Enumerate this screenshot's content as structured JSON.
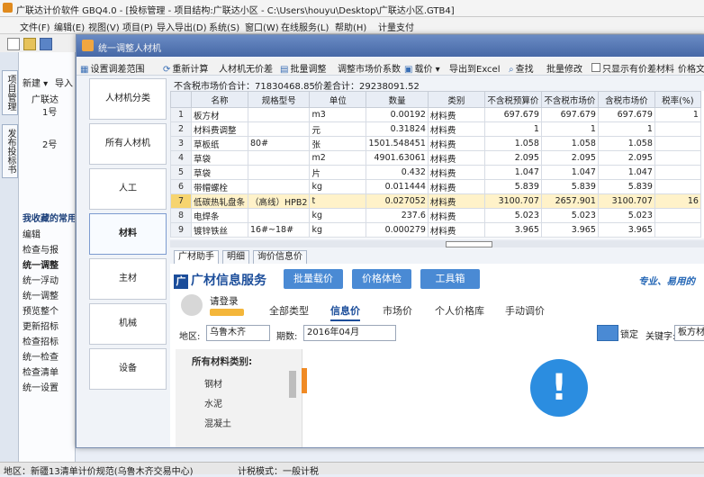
{
  "app": {
    "title": "广联达计价软件 GBQ4.0 - [投标管理 - 项目结构:广联达小区 - C:\\Users\\houyu\\Desktop\\广联达小区.GTB4]",
    "menu": [
      "文件(F)",
      "编辑(E)",
      "视图(V)",
      "项目(P)",
      "导入导出(D)",
      "系统(S)",
      "窗口(W)",
      "在线服务(L)",
      "帮助(H)",
      "计量支付"
    ],
    "vtabs": [
      "项目管理",
      "发布投标书"
    ],
    "left_toolbar": [
      "新建 ▾",
      "导入"
    ],
    "tree": [
      "广联达",
      "1号",
      "2号"
    ],
    "favorites_title": "我收藏的常用",
    "left_items": [
      "编辑",
      "检查与报",
      "统一调整",
      "统一浮动",
      "统一调整",
      "预览整个",
      "更新招标",
      "检查招标",
      "统一检查",
      "检查清单",
      "统一设置"
    ]
  },
  "dialog": {
    "title": "统一调整人材机",
    "toolbar": [
      "设置调差范围",
      "重新计算",
      "人材机无价差",
      "批量调整",
      "调整市场价系数",
      "载价 ▾",
      "导出到Excel",
      "查找",
      "批量修改",
      "只显示有价差材料",
      "价格文件"
    ],
    "sidebar": [
      "人材机分类",
      "所有人材机",
      "人工",
      "材料",
      "主材",
      "机械",
      "设备"
    ],
    "sidebar_active": 3,
    "summary": {
      "market_total": "不含税市场价合计：71830468.85",
      "diff_total": "价差合计：29238091.52"
    },
    "table": {
      "columns": [
        "",
        "名称",
        "规格型号",
        "单位",
        "数量",
        "类别",
        "不含税预算价",
        "不含税市场价",
        "含税市场价",
        "税率(%)"
      ],
      "selected_row": 6,
      "rows": [
        [
          "1",
          "板方材",
          "",
          "m3",
          "0.00192",
          "材料费",
          "697.679",
          "697.679",
          "697.679",
          "1"
        ],
        [
          "2",
          "材料费调整",
          "",
          "元",
          "0.31824",
          "材料费",
          "1",
          "1",
          "1",
          ""
        ],
        [
          "3",
          "草板纸",
          "80#",
          "张",
          "1501.548451",
          "材料费",
          "1.058",
          "1.058",
          "1.058",
          ""
        ],
        [
          "4",
          "草袋",
          "",
          "m2",
          "4901.63061",
          "材料费",
          "2.095",
          "2.095",
          "2.095",
          ""
        ],
        [
          "5",
          "草袋",
          "",
          "片",
          "0.432",
          "材料费",
          "1.047",
          "1.047",
          "1.047",
          ""
        ],
        [
          "6",
          "带帽螺栓",
          "",
          "kg",
          "0.011444",
          "材料费",
          "5.839",
          "5.839",
          "5.839",
          ""
        ],
        [
          "7",
          "低碳热轧盘条",
          "（高线）HPB2",
          "t",
          "0.027052",
          "材料费",
          "3100.707",
          "2657.901",
          "3100.707",
          "16"
        ],
        [
          "8",
          "电焊条",
          "",
          "kg",
          "237.6",
          "材料费",
          "5.023",
          "5.023",
          "5.023",
          ""
        ],
        [
          "9",
          "镀锌铁丝",
          "16#~18#",
          "kg",
          "0.000279",
          "材料费",
          "3.965",
          "3.965",
          "3.965",
          ""
        ]
      ]
    },
    "bottom_tabs": [
      "广材助手",
      "明细",
      "询价信息价"
    ],
    "gc": {
      "logo": "广材信息服务",
      "buttons": [
        "批量载价",
        "价格体检",
        "工具箱"
      ],
      "slogan": "专业、易用的",
      "login": "请登录",
      "sub_tabs": [
        "全部类型",
        "信息价",
        "市场价",
        "个人价格库",
        "手动调价"
      ],
      "sub_active": 1,
      "region_label": "地区:",
      "region": "乌鲁木齐",
      "period_label": "期数:",
      "period": "2016年04月",
      "lock": "锁定",
      "keyword_label": "关键字:",
      "keyword": "板方材",
      "cat_title": "所有材料类别:",
      "cats": [
        "钢材",
        "水泥",
        "混凝土"
      ]
    }
  },
  "status": {
    "left": "地区：新疆13清单计价规范(乌鲁木齐交易中心)",
    "mode": "计税模式：一般计税"
  },
  "colors": {
    "dialog_title": "#4668a6",
    "selected_row": "#fff2c9",
    "brand": "#1b4d9a",
    "button": "#4a8ad4"
  }
}
